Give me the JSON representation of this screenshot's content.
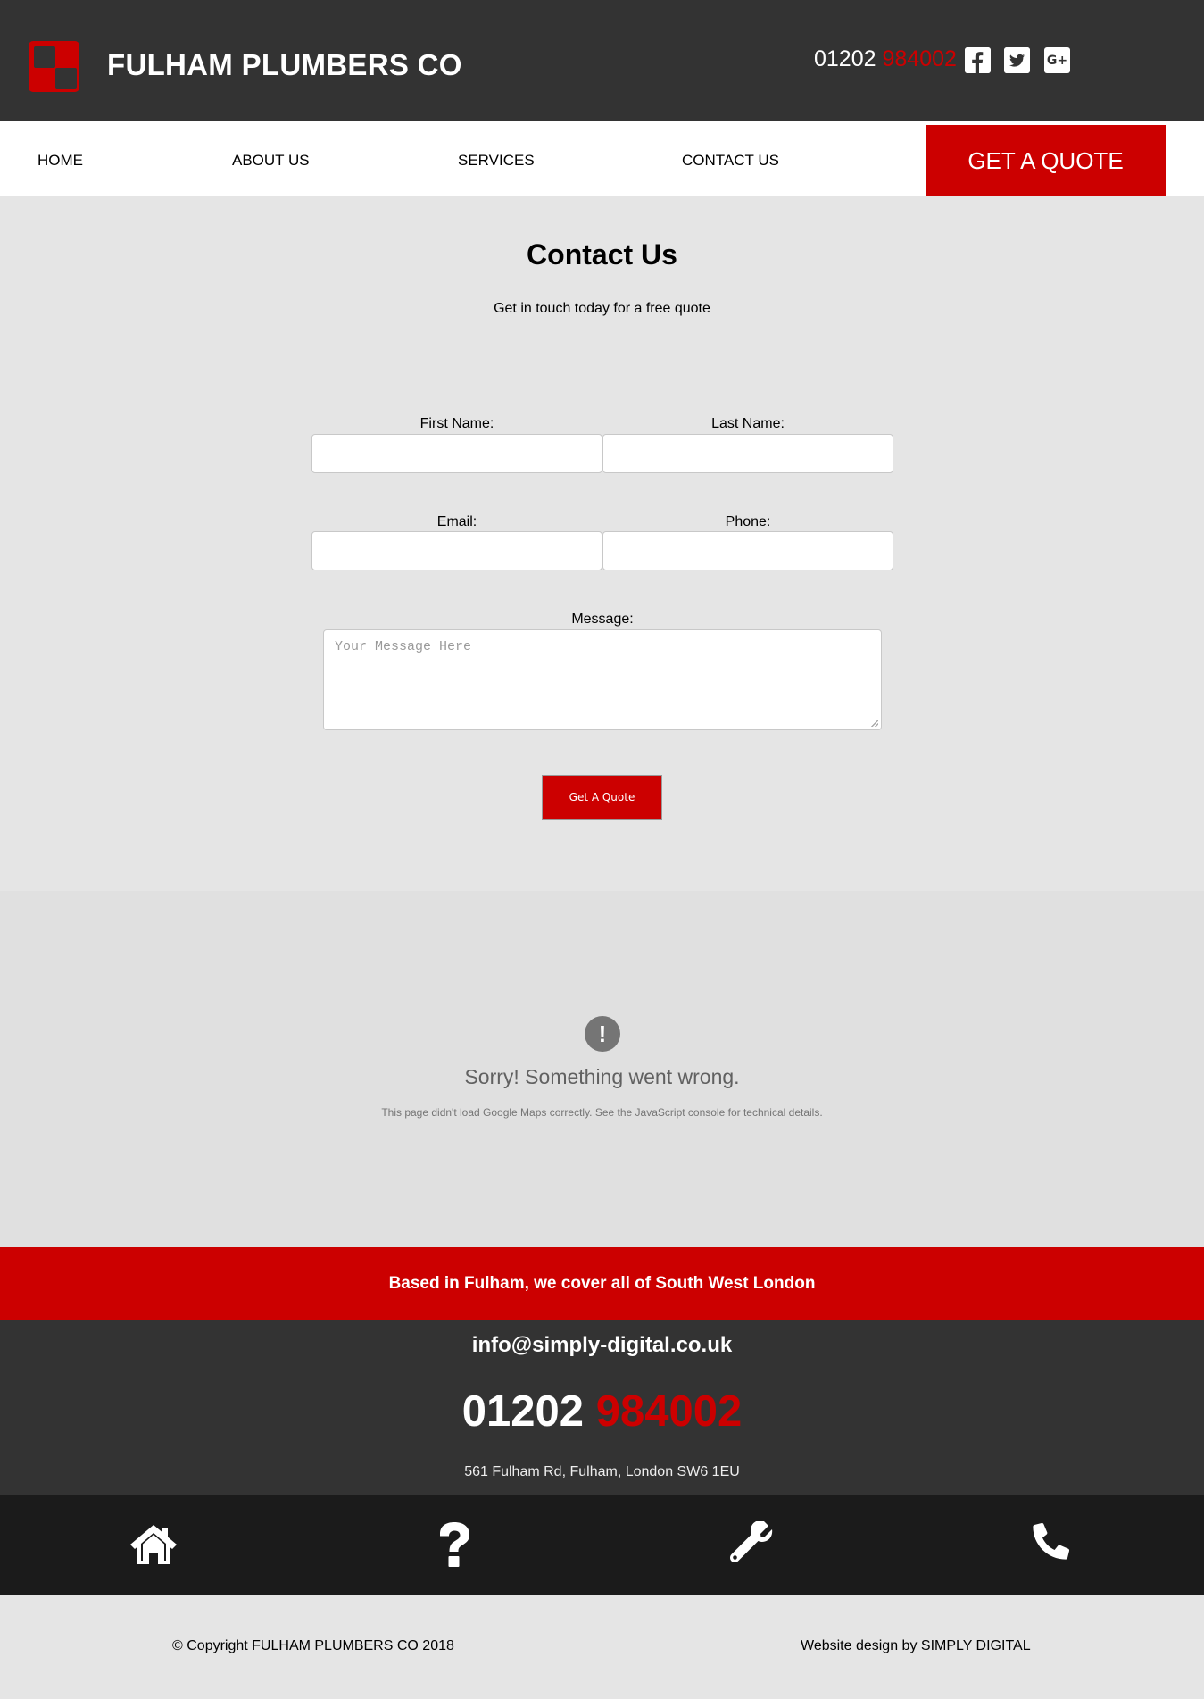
{
  "header": {
    "brand": "FULHAM PLUMBERS CO",
    "phone_prefix": "01202",
    "phone_suffix": "984002",
    "social": [
      "facebook-icon",
      "twitter-icon",
      "google-plus-icon"
    ],
    "google_plus_label": "G+"
  },
  "nav": {
    "items": [
      {
        "label": "HOME"
      },
      {
        "label": "ABOUT US"
      },
      {
        "label": "SERVICES"
      },
      {
        "label": "CONTACT US"
      }
    ],
    "cta": "GET A QUOTE"
  },
  "contact": {
    "title": "Contact Us",
    "subtitle": "Get in touch today for a free quote",
    "first_name_label": "First Name:",
    "last_name_label": "Last Name:",
    "email_label": "Email:",
    "phone_label": "Phone:",
    "message_label": "Message:",
    "message_placeholder": "Your Message Here",
    "submit_label": "Get A Quote"
  },
  "map_error": {
    "icon": "!",
    "title": "Sorry! Something went wrong.",
    "text": "This page didn't load Google Maps correctly. See the JavaScript console for technical details."
  },
  "banner": {
    "text": "Based in Fulham, we cover all of South West London"
  },
  "footer": {
    "email": "info@simply-digital.co.uk",
    "phone_prefix": "01202",
    "phone_suffix": "984002",
    "address": "561 Fulham Rd, Fulham, London SW6 1EU",
    "icons": [
      "home-icon",
      "question-icon",
      "wrench-icon",
      "phone-icon"
    ],
    "copyright": "© Copyright FULHAM PLUMBERS CO 2018",
    "credit": "Website design by SIMPLY DIGITAL"
  },
  "colors": {
    "accent": "#cc0000",
    "dark": "#333333",
    "darker": "#1b1b1b",
    "light": "#e5e5e5"
  }
}
